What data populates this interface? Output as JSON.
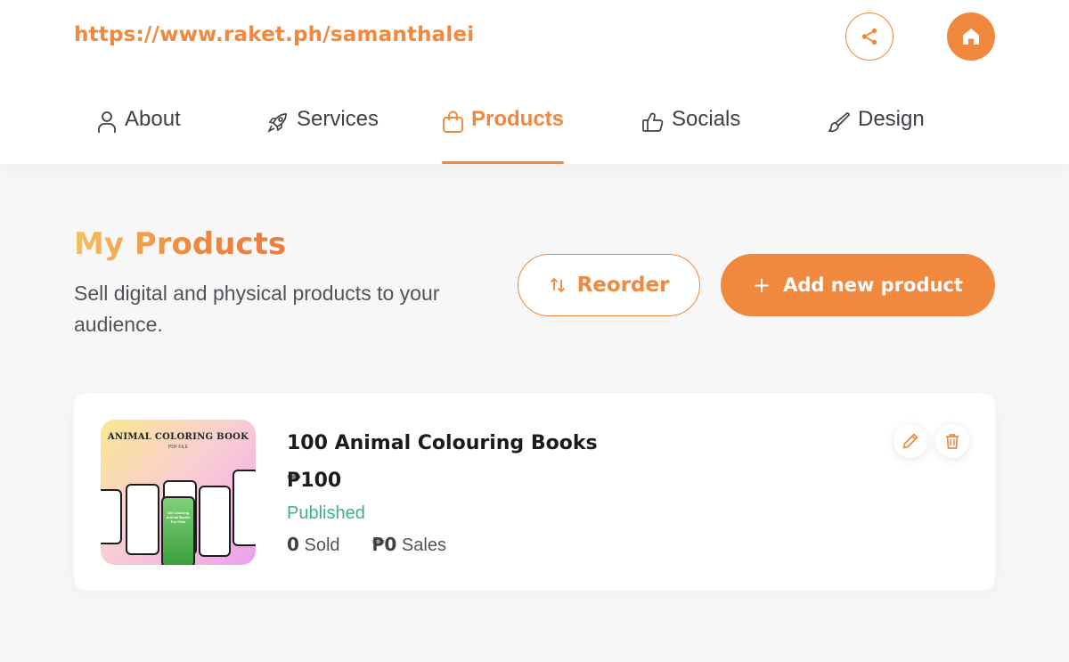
{
  "header": {
    "url": "https://www.raket.ph/samanthalei",
    "share_icon": "share-icon",
    "home_icon": "home-icon"
  },
  "tabs": [
    {
      "label": "About",
      "icon": "user-icon",
      "active": false
    },
    {
      "label": "Services",
      "icon": "rocket-icon",
      "active": false
    },
    {
      "label": "Products",
      "icon": "shopping-bag-icon",
      "active": true
    },
    {
      "label": "Socials",
      "icon": "thumbs-up-icon",
      "active": false
    },
    {
      "label": "Design",
      "icon": "brush-icon",
      "active": false
    }
  ],
  "section": {
    "title": "My Products",
    "description": "Sell digital and physical products to your audience.",
    "reorder_label": "Reorder",
    "add_label": "Add new product"
  },
  "products": [
    {
      "name": "100 Animal Colouring Books",
      "price": "₱100",
      "status": "Published",
      "sold_count": "0",
      "sold_label": "Sold",
      "sales_amount": "₱0",
      "sales_label": "Sales",
      "thumbnail": {
        "title": "ANIMAL COLORING BOOK",
        "subtitle": "PDF FILE",
        "phone_text": "100 Coloring Animal Books For Kids"
      }
    }
  ],
  "colors": {
    "accent": "#f0883e",
    "published": "#3fae94",
    "text_dark": "#1b1b1f",
    "background": "#f7f7f8"
  }
}
